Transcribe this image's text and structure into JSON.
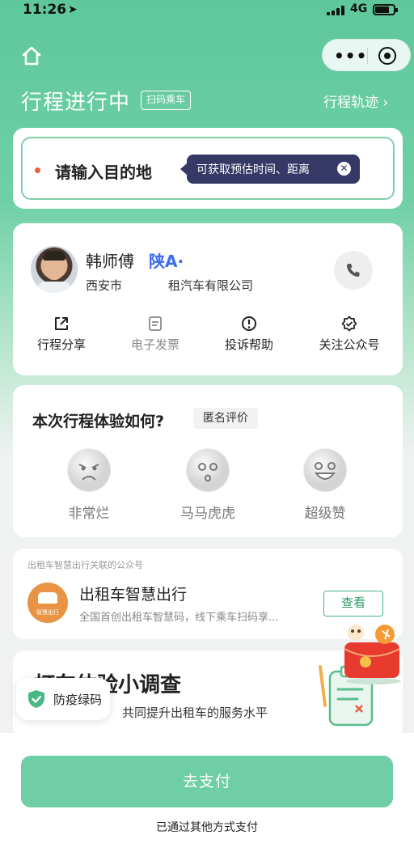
{
  "status_bar": {
    "time": "11:26",
    "network": "4G"
  },
  "header": {
    "title": "行程进行中",
    "scan_tag": "扫码乘车",
    "track_link": "行程轨迹 ›"
  },
  "destination": {
    "placeholder": "请输入目的地",
    "tooltip": "可获取预估时间、距离"
  },
  "driver": {
    "name": "韩师傅",
    "plate": "陕A·",
    "city": "西安市",
    "company": "租汽车有限公司",
    "actions": [
      {
        "label": "行程分享",
        "icon": "share-icon",
        "enabled": true
      },
      {
        "label": "电子发票",
        "icon": "invoice-icon",
        "enabled": false
      },
      {
        "label": "投诉帮助",
        "icon": "alert-icon",
        "enabled": true
      },
      {
        "label": "关注公众号",
        "icon": "follow-icon",
        "enabled": true
      }
    ]
  },
  "rating": {
    "title": "本次行程体验如何?",
    "anon_tag": "匿名评价",
    "options": [
      {
        "label": "非常烂",
        "icon": "angry-face-icon"
      },
      {
        "label": "马马虎虎",
        "icon": "neutral-face-icon"
      },
      {
        "label": "超级赞",
        "icon": "happy-face-icon"
      }
    ]
  },
  "mp": {
    "caption": "出租车智慧出行关联的公众号",
    "logo_caption": "智慧出行",
    "name": "出租车智慧出行",
    "desc": "全国首创出租车智慧码，线下乘车扫码享...",
    "view_label": "查看"
  },
  "survey": {
    "title": "打车体验小调查",
    "subtitle": "共同提升出租车的服务水平"
  },
  "greencode": {
    "label": "防疫绿码"
  },
  "bottom": {
    "pay_label": "去支付",
    "paid_other": "已通过其他方式支付"
  },
  "colors": {
    "brand_green": "#5ec79c",
    "pay_button": "#6fcea5",
    "plate_blue": "#3d6cf0",
    "tooltip_bg": "#363866"
  }
}
